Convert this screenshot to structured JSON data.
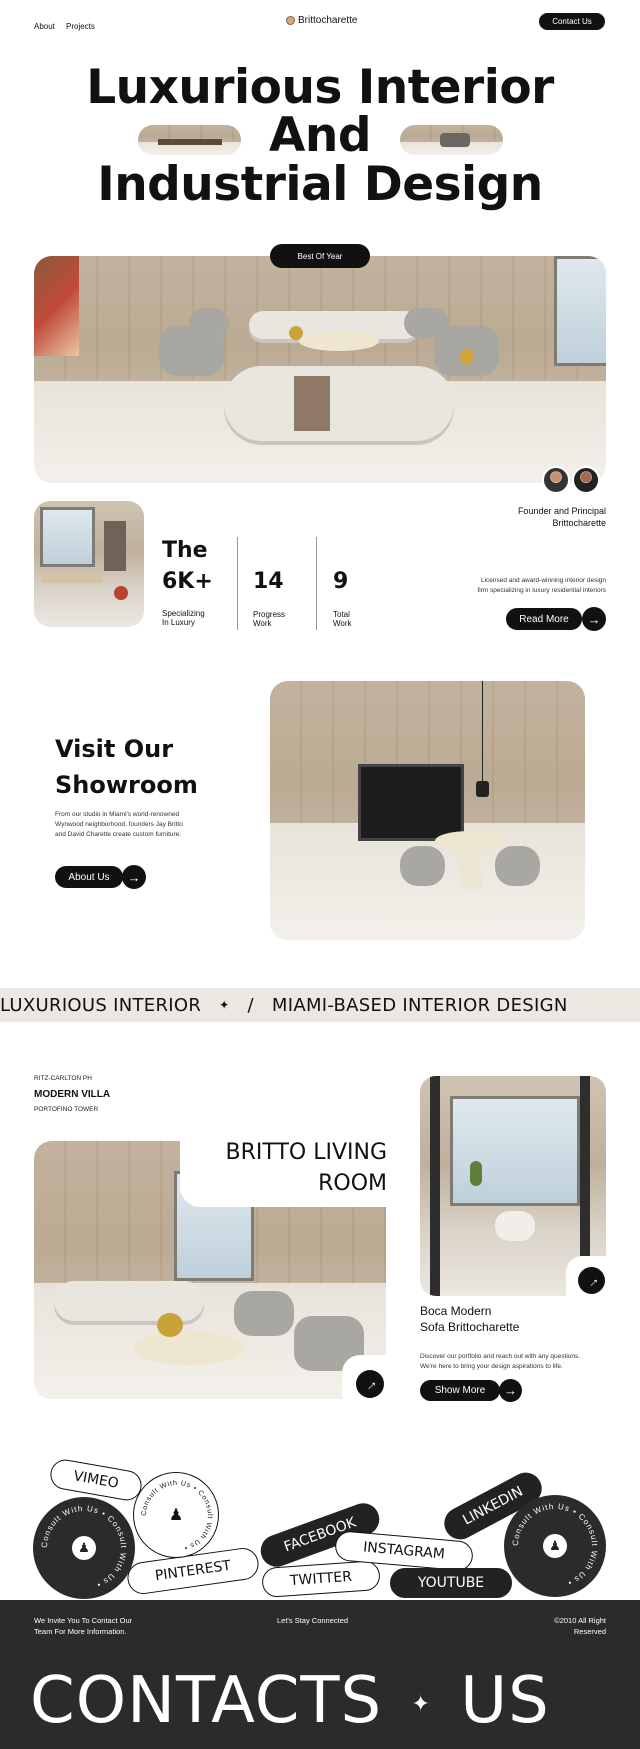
{
  "nav": {
    "links": [
      "About",
      "Projects"
    ],
    "brand": "Brittocharette",
    "contact_button": "Contact Us"
  },
  "hero": {
    "line1": "Luxurious Interior",
    "line2": "And",
    "line3": "Industrial Design",
    "badge": "Best Of Year"
  },
  "founder": {
    "role": "Founder and Principal",
    "name": "Brittocharette",
    "description_line1": "Licensed and award-winning interior design",
    "description_line2": "firm specializing in luxury residential interiors",
    "read_more": "Read More"
  },
  "stats": [
    {
      "value_top": "The",
      "value": "6K+",
      "label_line1": "Specializing",
      "label_line2": "In Luxury"
    },
    {
      "value": "14",
      "label_line1": "Progress",
      "label_line2": "Work"
    },
    {
      "value": "9",
      "label_line1": "Total",
      "label_line2": "Work"
    }
  ],
  "showroom": {
    "title_line1": "Visit Our",
    "title_line2": "Showroom",
    "text_line1": "From our studio in Miami's world-renowned",
    "text_line2": "Wynwood neighborhood, founders Jay Britto",
    "text_line3": "and David Charette create custom furniture.",
    "button": "About Us"
  },
  "ticker": {
    "item1": "LUXURIOUS INTERIOR",
    "sep1": "✦",
    "sep2": "/",
    "item2": "MIAMI-BASED INTERIOR DESIGN"
  },
  "projects": {
    "label1": "RITZ-CARLTON PH",
    "label2": "MODERN VILLA",
    "label3": "PORTOFINO TOWER",
    "title_line1": "BRITTO LIVING",
    "title_line2": "ROOM",
    "side_title_line1": "Boca Modern",
    "side_title_line2": "Sofa Brittocharette",
    "side_text_line1": "Discover our portfolio and reach out with any questions.",
    "side_text_line2": "We're here to bring your design aspirations to life.",
    "show_more": "Show More"
  },
  "social": {
    "vimeo": "VIMEO",
    "pinterest": "PINTEREST",
    "facebook": "FACEBOOK",
    "twitter": "TWITTER",
    "instagram": "INSTAGRAM",
    "linkedin": "LINKEDIN",
    "youtube": "YOUTUBE",
    "badge_text": "Consult With Us • Consult With Us • "
  },
  "footer": {
    "invite_line1": "We Invite You To Contact Our",
    "invite_line2": "Team For More Information.",
    "stay": "Let's Stay Connected",
    "copyright_line1": "©2010 All Right",
    "copyright_line2": "Reserved",
    "big_left": "CONTACTS",
    "big_sep": "✦",
    "big_right": "US"
  }
}
